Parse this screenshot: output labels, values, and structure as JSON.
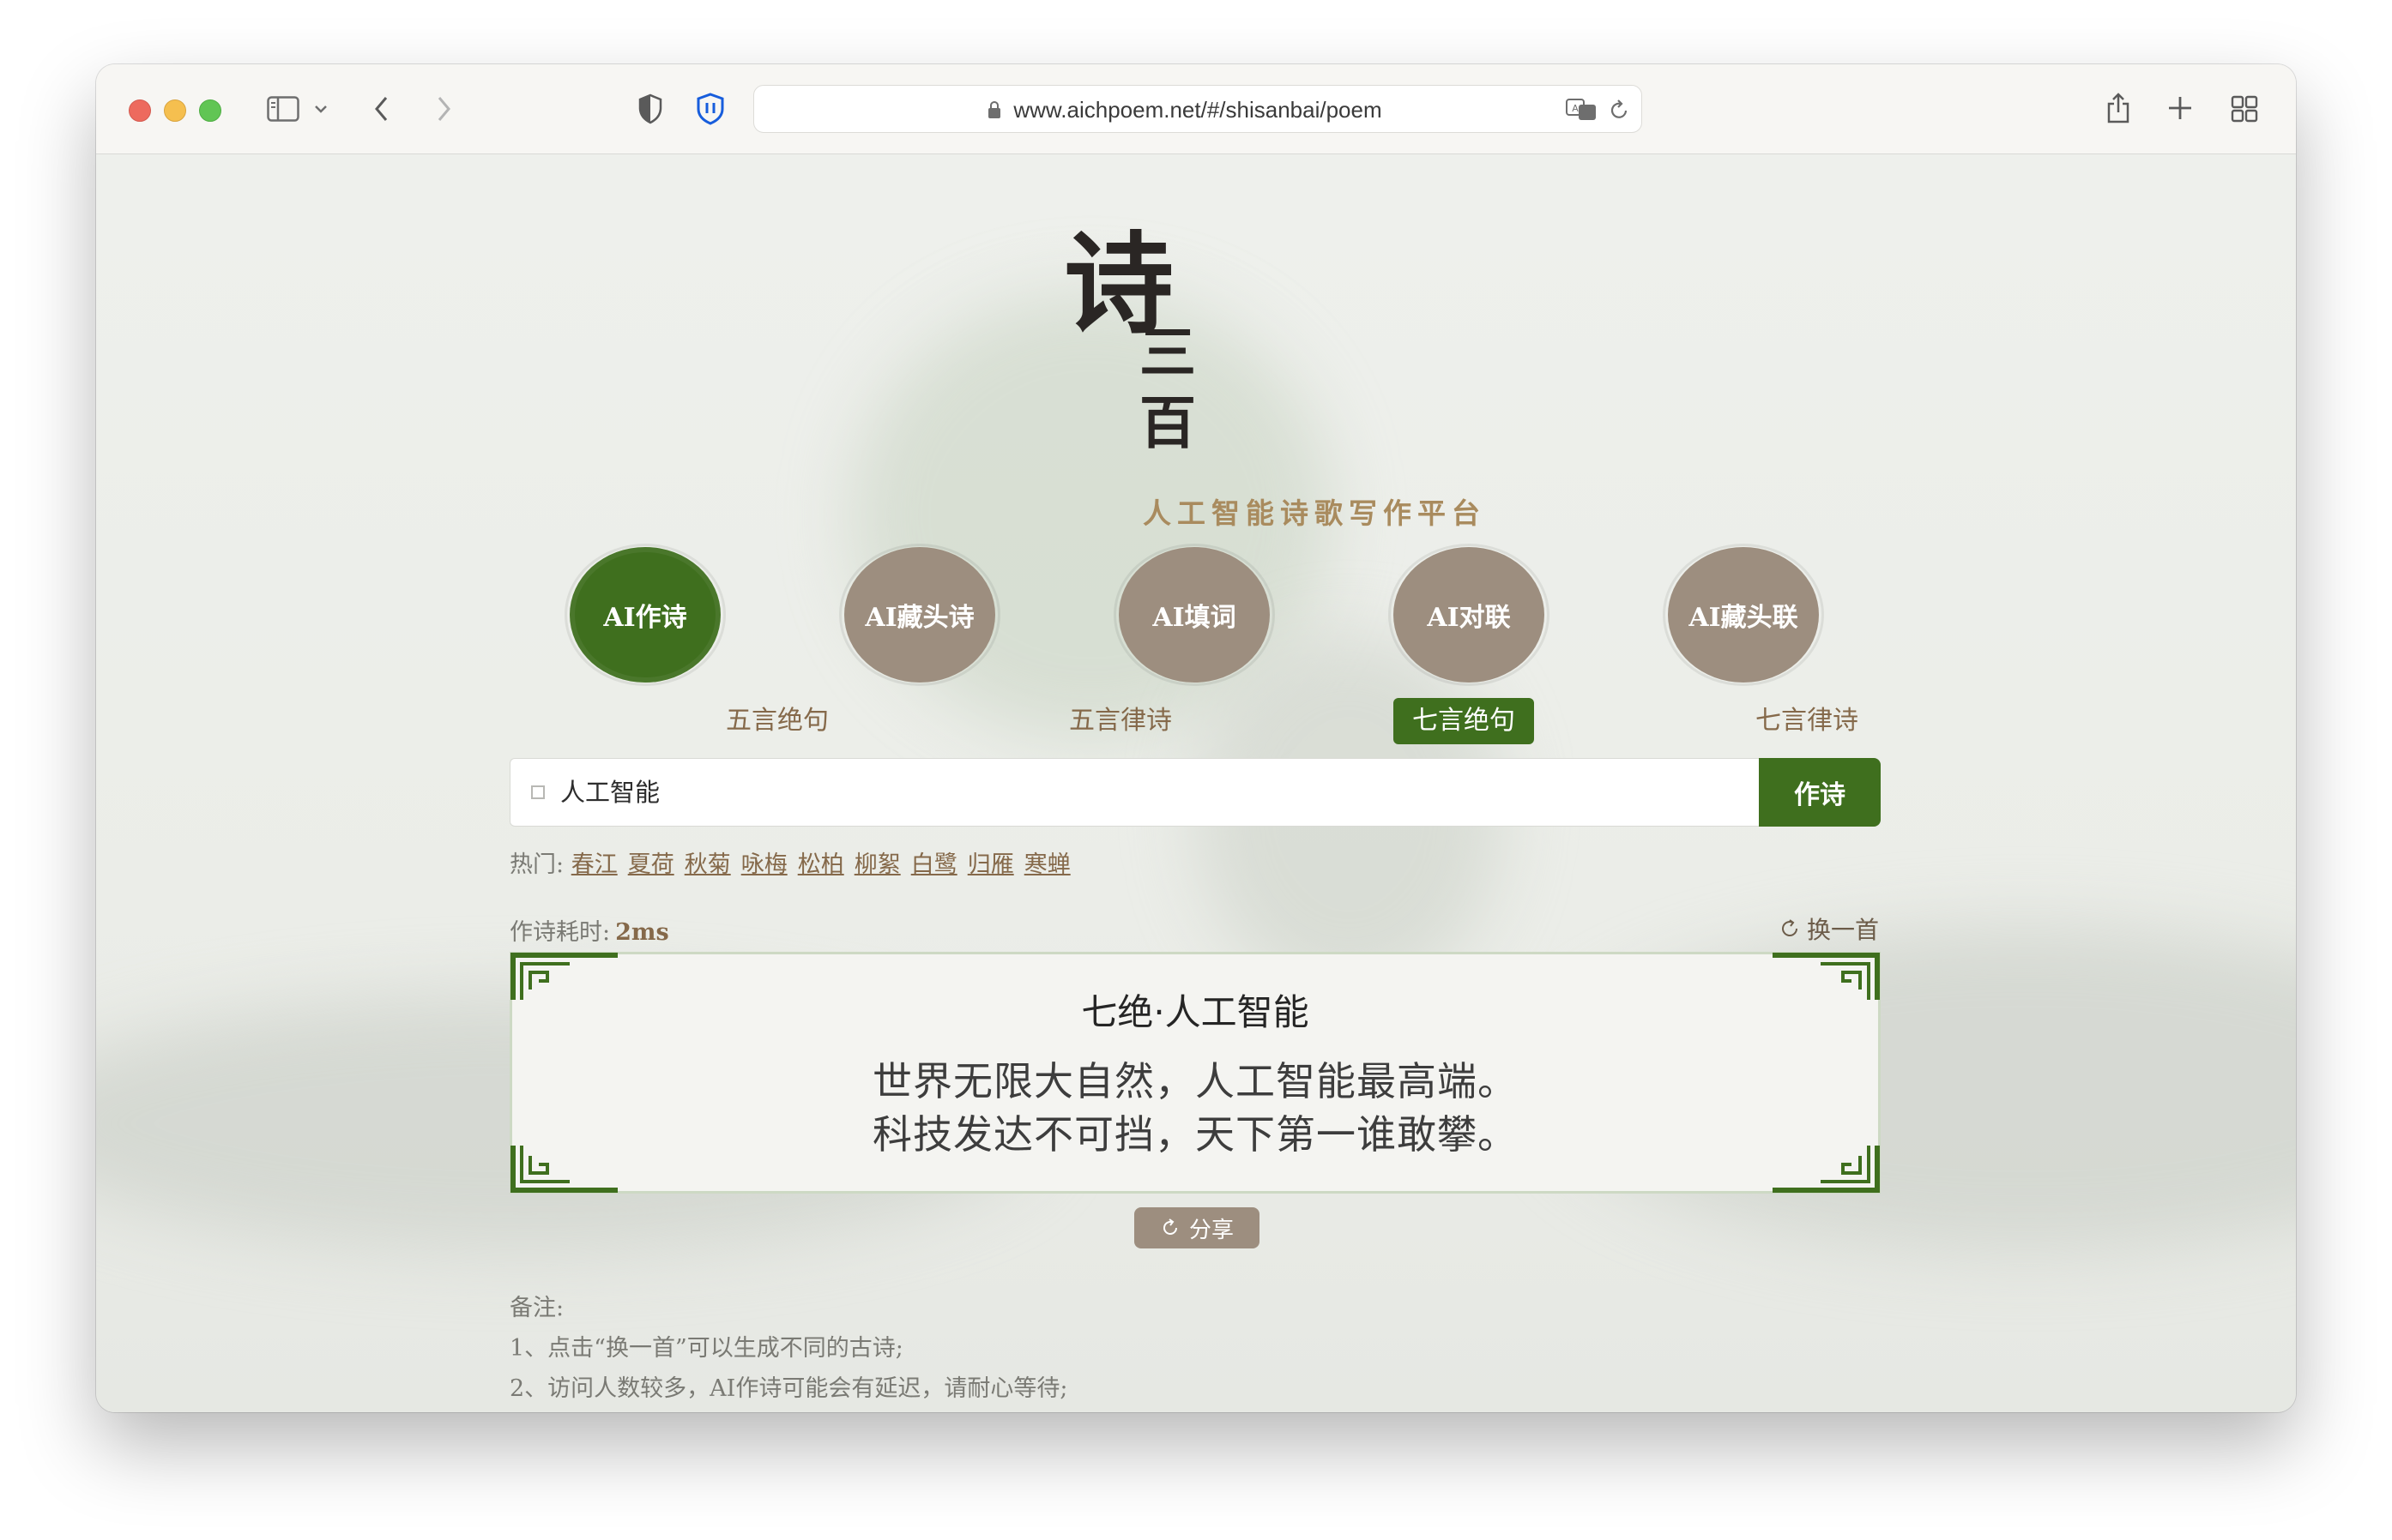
{
  "browser": {
    "url": "www.aichpoem.net/#/shisanbai/poem"
  },
  "logo": {
    "big_char": "诗",
    "small_char_1": "三",
    "small_char_2": "百",
    "subtitle": "人工智能诗歌写作平台"
  },
  "modes": [
    {
      "label": "AI作诗",
      "active": true
    },
    {
      "label": "AI藏头诗",
      "active": false
    },
    {
      "label": "AI填词",
      "active": false
    },
    {
      "label": "AI对联",
      "active": false
    },
    {
      "label": "AI藏头联",
      "active": false
    }
  ],
  "poem_types": [
    {
      "label": "五言绝句",
      "active": false
    },
    {
      "label": "五言律诗",
      "active": false
    },
    {
      "label": "七言绝句",
      "active": true
    },
    {
      "label": "七言律诗",
      "active": false
    }
  ],
  "search": {
    "value": "人工智能",
    "submit_label": "作诗"
  },
  "hot": {
    "label": "热门:",
    "topics": [
      "春江",
      "夏荷",
      "秋菊",
      "咏梅",
      "松柏",
      "柳絮",
      "白鹭",
      "归雁",
      "寒蝉"
    ]
  },
  "timing": {
    "label": "作诗耗时:",
    "value": "2ms"
  },
  "refresh_label": "换一首",
  "poem": {
    "title": "七绝·人工智能",
    "lines": [
      "世界无限大自然，人工智能最高端。",
      "科技发达不可挡，天下第一谁敢攀。"
    ]
  },
  "share_label": "分享",
  "notes": {
    "heading": "备注:",
    "items": [
      "1、点击“换一首”可以生成不同的古诗;",
      "2、访问人数较多，AI作诗可能会有延迟，请耐心等待;"
    ]
  },
  "colors": {
    "accent_green": "#3f6f1e",
    "muted_brown": "#9d8e7f",
    "gold": "#a98b5e"
  }
}
